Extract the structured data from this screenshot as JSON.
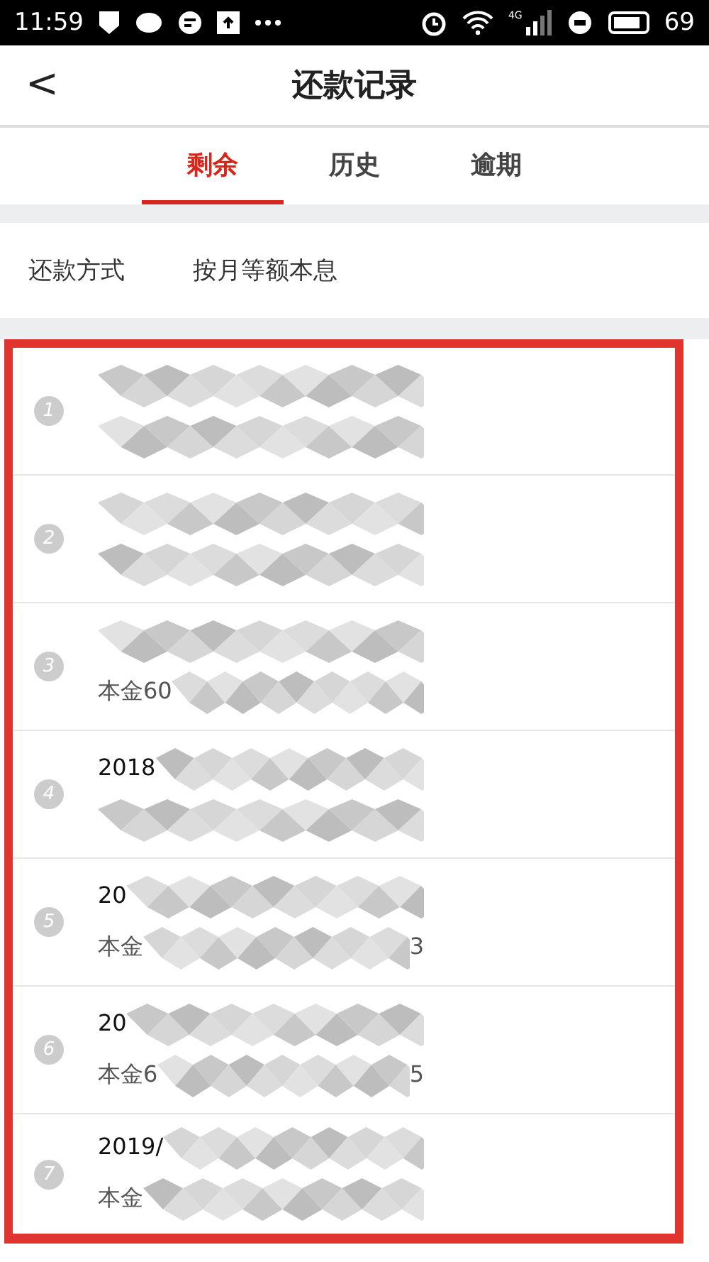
{
  "status_bar": {
    "time": "11:59",
    "network": "4G",
    "battery": "69"
  },
  "header": {
    "back": "<",
    "title": "还款记录"
  },
  "tabs": [
    {
      "label": "剩余",
      "selected": true
    },
    {
      "label": "历史",
      "selected": false
    },
    {
      "label": "逾期",
      "selected": false
    }
  ],
  "repayment_method": {
    "label": "还款方式",
    "value": "按月等额本息"
  },
  "records": [
    {
      "index": "1"
    },
    {
      "index": "2"
    },
    {
      "index": "3",
      "line_2": "本金60"
    },
    {
      "index": "4",
      "line_1": "2018"
    },
    {
      "index": "5",
      "line_1": "20",
      "line_2": "本金",
      "line_2_end": "3"
    },
    {
      "index": "6",
      "line_1": "20",
      "line_2": "本金6",
      "line_2_end": "5"
    },
    {
      "index": "7",
      "line_1": "2019/",
      "line_2": "本金"
    }
  ]
}
